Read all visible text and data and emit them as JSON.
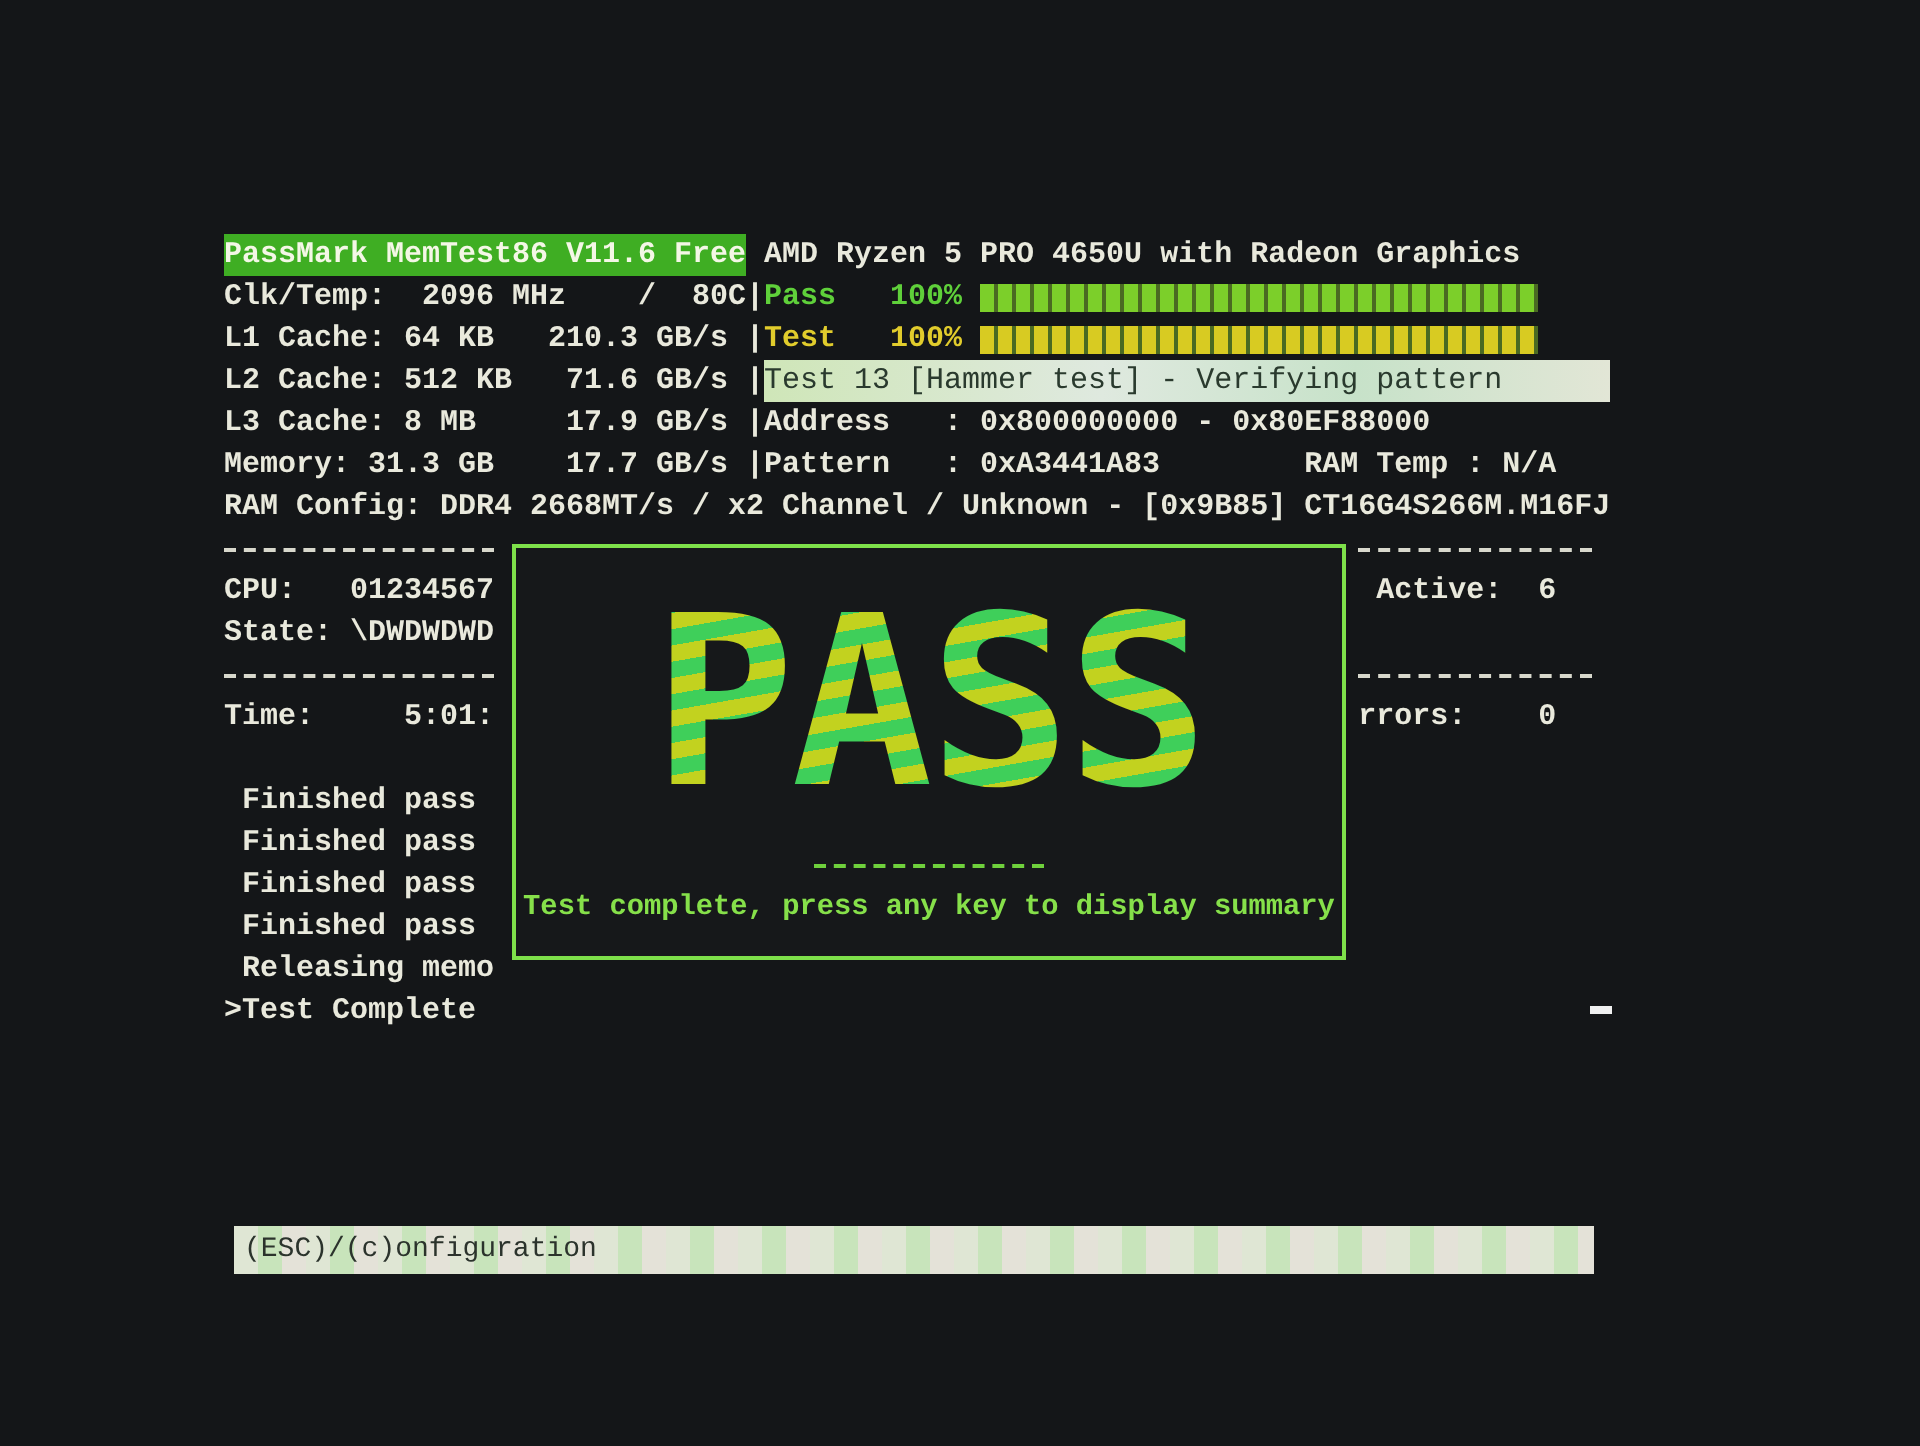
{
  "title": "PassMark MemTest86 V11.6 Free",
  "cpu_name": "AMD Ryzen 5 PRO 4650U with Radeon Graphics",
  "info_lines": [
    "Clk/Temp:  2096 MHz    /  80C|",
    "L1 Cache: 64 KB   210.3 GB/s |",
    "L2 Cache: 512 KB   71.6 GB/s |",
    "L3 Cache: 8 MB     17.9 GB/s |",
    "Memory: 31.3 GB    17.7 GB/s |"
  ],
  "progress": [
    {
      "kind": "pass",
      "label": "Pass",
      "percent": "100%",
      "level": 1
    },
    {
      "kind": "test",
      "label": "Test",
      "percent": "100%",
      "level": 1
    }
  ],
  "test_status": "Test 13 [Hammer test] - Verifying pattern",
  "address": "Address   : 0x800000000 - 0x80EF88000",
  "pattern": "Pattern   : 0xA3441A83",
  "ram_temp": "RAM Temp : N/A",
  "ram_config": "RAM Config: DDR4 2668MT/s / x2 Channel / Unknown - [0x9B85] CT16G4S266M.M16FJ",
  "cpu_line": "CPU:   01234567",
  "state_line": "State: \\DWDWDWD",
  "active_line": "Active:  6",
  "time_line": "Time:     5:01:",
  "errors_line": "rrors:    0",
  "log": [
    {
      "text": "Finished pass"
    },
    {
      "text": "Finished pass"
    },
    {
      "text": "Finished pass"
    },
    {
      "text": "Finished pass"
    },
    {
      "text": "Releasing memo"
    },
    {
      "marker": ">",
      "text": "Test Complete"
    }
  ],
  "dialog": {
    "banner": "PASS",
    "message": "Test complete, press any key to display summary"
  },
  "footer": "(ESC)/(c)onfiguration"
}
